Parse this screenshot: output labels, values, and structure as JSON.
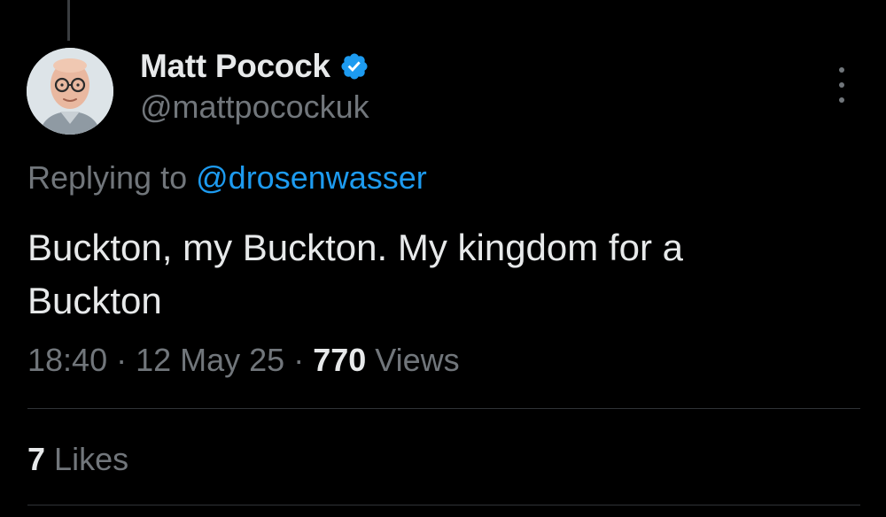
{
  "author": {
    "display_name": "Matt Pocock",
    "handle": "@mattpocockuk",
    "verified": true
  },
  "reply": {
    "prefix": "Replying to",
    "mention": "@drosenwasser"
  },
  "tweet": {
    "text": "Buckton, my Buckton. My kingdom for a Buckton"
  },
  "meta": {
    "time": "18:40",
    "separator": " · ",
    "date": "12 May 25",
    "views_count": "770",
    "views_label": "Views"
  },
  "engagement": {
    "likes_count": "7",
    "likes_label": "Likes"
  },
  "icons": {
    "verified": "verified-badge-icon",
    "more": "more-vertical-icon"
  },
  "colors": {
    "background": "#000000",
    "text_primary": "#e7e9ea",
    "text_secondary": "#71767b",
    "accent": "#1d9bf0",
    "divider": "#2f3336"
  }
}
